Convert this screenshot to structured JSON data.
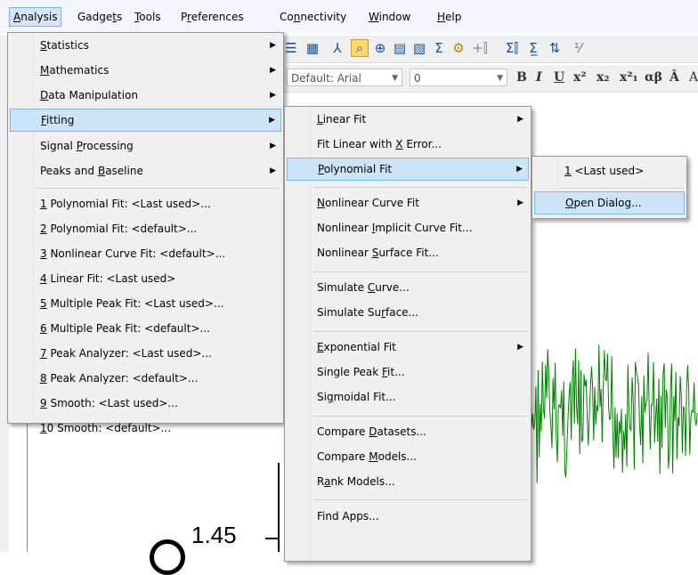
{
  "menubar": {
    "items": [
      {
        "label": "Analysis",
        "u": "A",
        "rest": "nalysis"
      },
      {
        "label": "Gadgets",
        "pre": "Gadge",
        "u": "t",
        "rest": "s"
      },
      {
        "label": "Tools",
        "u": "T",
        "rest": "ools"
      },
      {
        "label": "Preferences",
        "pre": "P",
        "u": "r",
        "rest": "eferences"
      },
      {
        "label": "Connectivity",
        "pre": "Co",
        "u": "n",
        "rest": "nectivity"
      },
      {
        "label": "Window",
        "u": "W",
        "rest": "indow"
      },
      {
        "label": "Help",
        "u": "H",
        "rest": "elp"
      }
    ]
  },
  "format_toolbar": {
    "font_value": "Default: Arial",
    "size_value": "0"
  },
  "graph": {
    "y_tick_label": "1.45",
    "series_color": "#008000"
  },
  "analysis_menu": {
    "items": [
      {
        "pre": "",
        "u": "S",
        "rest": "tatistics",
        "submenu": true
      },
      {
        "pre": "",
        "u": "M",
        "rest": "athematics",
        "submenu": true
      },
      {
        "pre": "",
        "u": "D",
        "rest": "ata Manipulation",
        "submenu": true
      },
      {
        "pre": "",
        "u": "F",
        "rest": "itting",
        "submenu": true
      },
      {
        "pre": "Signal ",
        "u": "P",
        "rest": "rocessing",
        "submenu": true
      },
      {
        "pre": "Peaks and ",
        "u": "B",
        "rest": "aseline",
        "submenu": true
      },
      {
        "pre": "",
        "u": "1",
        "rest": " Polynomial Fit: <Last used>..."
      },
      {
        "pre": "",
        "u": "2",
        "rest": " Polynomial Fit: <default>..."
      },
      {
        "pre": "",
        "u": "3",
        "rest": " Nonlinear Curve Fit: <default>..."
      },
      {
        "pre": "",
        "u": "4",
        "rest": " Linear Fit: <Last used>"
      },
      {
        "pre": "",
        "u": "5",
        "rest": " Multiple Peak Fit: <Last used>..."
      },
      {
        "pre": "",
        "u": "6",
        "rest": " Multiple Peak Fit: <default>..."
      },
      {
        "pre": "",
        "u": "7",
        "rest": " Peak Analyzer: <Last used>..."
      },
      {
        "pre": "",
        "u": "8",
        "rest": " Peak Analyzer: <default>..."
      },
      {
        "pre": "",
        "u": "9",
        "rest": " Smooth: <Last used>..."
      },
      {
        "pre": "",
        "u": "1",
        "rest": "0 Smooth: <default>..."
      }
    ]
  },
  "fitting_menu": {
    "items": [
      {
        "pre": "",
        "u": "L",
        "rest": "inear Fit",
        "submenu": true
      },
      {
        "pre": "Fit Linear with ",
        "u": "X",
        "rest": " Error..."
      },
      {
        "pre": "",
        "u": "P",
        "rest": "olynomial Fit",
        "submenu": true
      },
      {
        "pre": "",
        "u": "N",
        "rest": "onlinear Curve Fit",
        "submenu": true
      },
      {
        "pre": "Nonlinear ",
        "u": "I",
        "rest": "mplicit Curve Fit..."
      },
      {
        "pre": "Nonlinear ",
        "u": "S",
        "rest": "urface Fit..."
      },
      {
        "pre": "Simulate ",
        "u": "C",
        "rest": "urve..."
      },
      {
        "pre": "Simulate Su",
        "u": "r",
        "rest": "face..."
      },
      {
        "pre": "",
        "u": "E",
        "rest": "xponential Fit",
        "submenu": true
      },
      {
        "pre": "Single Peak ",
        "u": "F",
        "rest": "it..."
      },
      {
        "pre": "Si",
        "u": "g",
        "rest": "moidal Fit..."
      },
      {
        "pre": "Compare ",
        "u": "D",
        "rest": "atasets..."
      },
      {
        "pre": "Compare ",
        "u": "M",
        "rest": "odels..."
      },
      {
        "pre": "R",
        "u": "a",
        "rest": "nk Models..."
      },
      {
        "pre": "Find Apps...",
        "u": "",
        "rest": ""
      }
    ]
  },
  "polynomial_menu": {
    "items": [
      {
        "pre": "",
        "u": "1",
        "rest": " <Last used>"
      },
      {
        "pre": "",
        "u": "O",
        "rest": "pen Dialog..."
      }
    ]
  }
}
